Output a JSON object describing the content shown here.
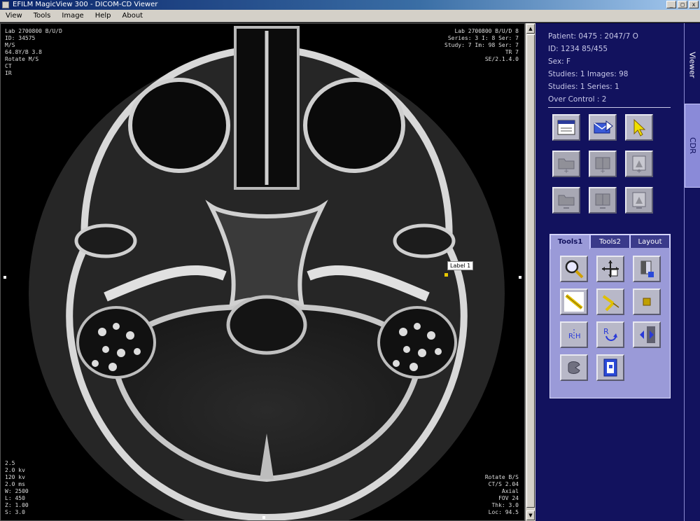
{
  "window": {
    "title": "EFILM MagicView 300 - DICOM-CD Viewer",
    "minimize": "_",
    "maximize": "□",
    "close": "x"
  },
  "menu": [
    "View",
    "Tools",
    "Image",
    "Help",
    "About"
  ],
  "viewer": {
    "overlay_tl": "Lab 2700800 B/U/D\nID: 34575\nM/S\n64.8Y/B 3.8\nRotate M/S\nCT\nIR\n",
    "overlay_tr": "Lab 2700800 B/U/D 8\nSeries: 3 I: 8 Ser: 7\nStudy: 7 Im: 98 Ser: 7\nTR 7\nSE/2.1.4.0",
    "overlay_bl": "2.5\n2.0 kv\n120 kv\n2.0 ms\nW: 2500\nL: 450\nZ: 1.00\nS: 3.0",
    "overlay_br": "Rotate B/S\nCT/S 2.04\nAxial\nFOV 24\nThk: 3.0\nLoc: 94.5",
    "marker_label": "Label 1"
  },
  "scrollbar": {
    "up": "▲",
    "down": "▼"
  },
  "panel": {
    "info": [
      "Patient: 0475 : 2047/7 O",
      "ID: 1234 85/455",
      "Sex: F",
      "Studies: 1   Images: 98",
      "Studies: 1 Series: 1",
      "Over Control : 2"
    ],
    "tool_tabs": [
      "Tools1",
      "Tools2",
      "Layout"
    ],
    "active_tab": 0
  },
  "side_tabs": [
    "Viewer",
    "CDR"
  ],
  "colors": {
    "panel_bg": "#12125e",
    "tools_bg": "#9a9ad8",
    "marker": "#e8c800"
  }
}
